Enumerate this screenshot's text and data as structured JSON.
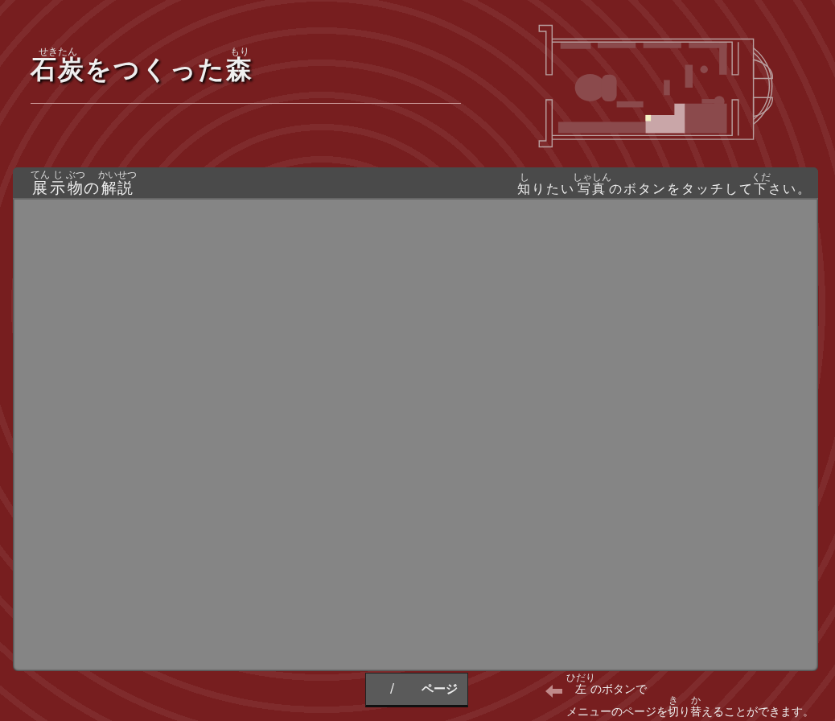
{
  "title": [
    {
      "text": "石炭",
      "ruby": "せきたん"
    },
    {
      "text": "をつくった"
    },
    {
      "text": "森",
      "ruby": "もり"
    }
  ],
  "floor_map": {
    "current_spot_marked": true
  },
  "panel": {
    "heading": [
      {
        "text": "展",
        "ruby": "てん"
      },
      {
        "text": "示",
        "ruby": "じ"
      },
      {
        "text": "物",
        "ruby": "ぶつ"
      },
      {
        "text": "の"
      },
      {
        "text": "解説",
        "ruby": "かいせつ"
      }
    ],
    "instruction": [
      {
        "text": "知",
        "ruby": "し"
      },
      {
        "text": "りたい"
      },
      {
        "text": "写真",
        "ruby": "しゃしん"
      },
      {
        "text": "のボタンをタッチして"
      },
      {
        "text": "下",
        "ruby": "くだ"
      },
      {
        "text": "さい。"
      }
    ]
  },
  "page_indicator": {
    "separator": "/",
    "unit": "ページ"
  },
  "hint": {
    "line_1": [
      {
        "text": "左",
        "ruby": "ひだり"
      },
      {
        "text": "のボタンで"
      }
    ],
    "line_2": [
      {
        "text": "メニューのページを"
      },
      {
        "text": "切",
        "ruby": "き"
      },
      {
        "text": "り"
      },
      {
        "text": "替",
        "ruby": "か"
      },
      {
        "text": "えることができます。"
      }
    ]
  }
}
